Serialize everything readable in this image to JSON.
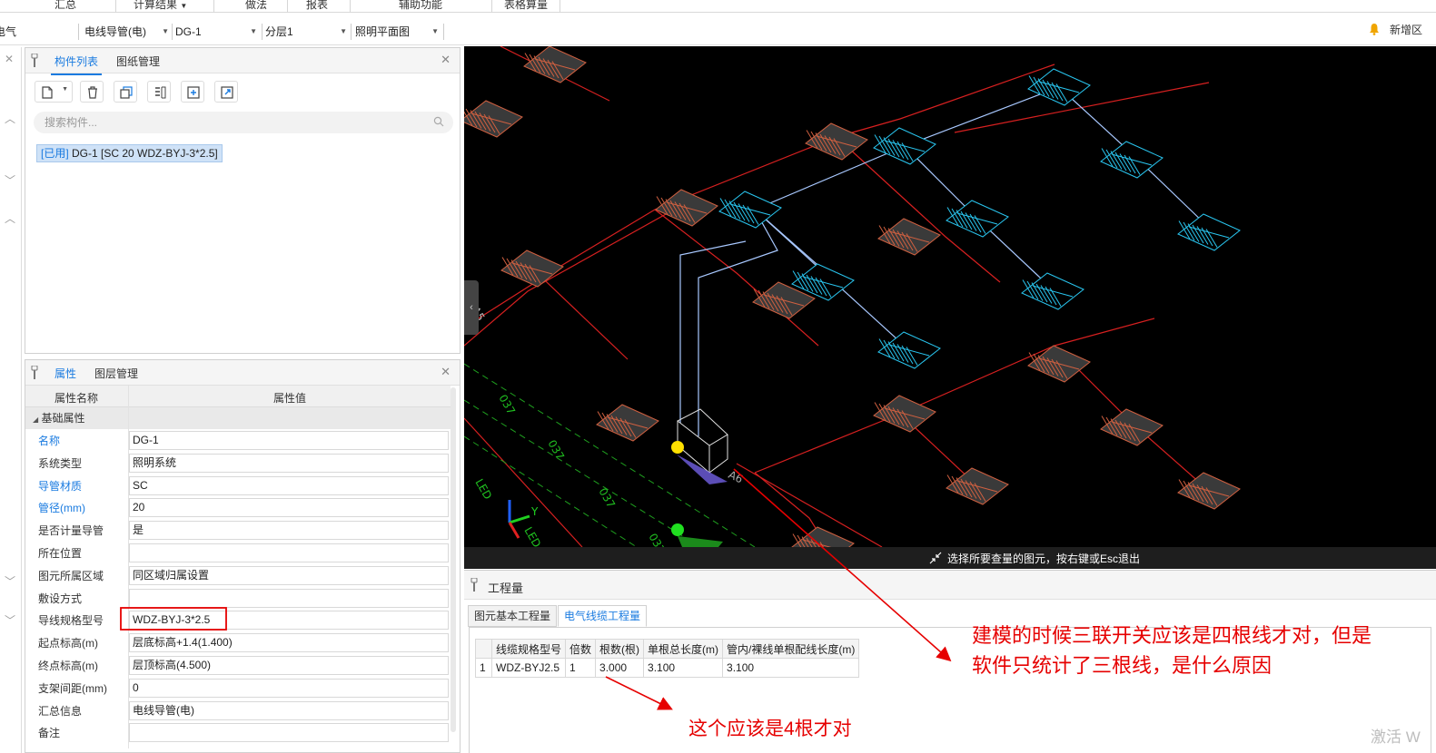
{
  "menu": {
    "items": [
      "汇总",
      "计算结果",
      "做法",
      "报表",
      "辅助功能",
      "表格算量"
    ]
  },
  "selectors": {
    "discipline": "电气",
    "type": "电线导管(电)",
    "component": "DG-1",
    "layer": "分层1",
    "drawing": "照明平面图"
  },
  "header_right": {
    "new_area": "新增区"
  },
  "component_panel": {
    "tabs": [
      "构件列表",
      "图纸管理"
    ],
    "search_placeholder": "搜索构件...",
    "item_tag": "[已用]",
    "item_label": "DG-1 [SC 20 WDZ-BYJ-3*2.5]"
  },
  "property_panel": {
    "tabs": [
      "属性",
      "图层管理"
    ],
    "col_name": "属性名称",
    "col_value": "属性值",
    "group": "基础属性",
    "rows": [
      {
        "name": "名称",
        "value": "DG-1"
      },
      {
        "name": "系统类型",
        "value": "照明系统"
      },
      {
        "name": "导管材质",
        "value": "SC"
      },
      {
        "name": "管径(mm)",
        "value": "20"
      },
      {
        "name": "是否计量导管",
        "value": "是"
      },
      {
        "name": "所在位置",
        "value": ""
      },
      {
        "name": "图元所属区域",
        "value": "同区域归属设置"
      },
      {
        "name": "敷设方式",
        "value": ""
      },
      {
        "name": "导线规格型号",
        "value": "WDZ-BYJ-3*2.5"
      },
      {
        "name": "起点标高(m)",
        "value": "层底标高+1.4(1.400)"
      },
      {
        "name": "终点标高(m)",
        "value": "层顶标高(4.500)"
      },
      {
        "name": "支架间距(mm)",
        "value": "0"
      },
      {
        "name": "汇总信息",
        "value": "电线导管(电)"
      },
      {
        "name": "备注",
        "value": ""
      }
    ]
  },
  "cad": {
    "status_text": "选择所要查量的图元，按右键或Esc退出",
    "labels": [
      "A5",
      "037",
      "037",
      "037",
      "037",
      "LED",
      "LED",
      "A6",
      "A6"
    ],
    "axis_y": "Y"
  },
  "quantity_panel": {
    "title": "工程量",
    "tabs": [
      "图元基本工程量",
      "电气线缆工程量"
    ],
    "headers": [
      "线缆规格型号",
      "倍数",
      "根数(根)",
      "单根总长度(m)",
      "管内/裸线单根配线长度(m)"
    ],
    "rows": [
      {
        "index": "1",
        "model": "WDZ-BYJ2.5",
        "multiple": "1",
        "count": "3.000",
        "total_len": "3.100",
        "inner_len": "3.100"
      }
    ]
  },
  "annotations": {
    "question_line1": "建模的时候三联开关应该是四根线才对，但是",
    "question_line2": "软件只统计了三根线，是什么原因",
    "note": "这个应该是4根才对"
  },
  "watermark": "激活 W"
}
